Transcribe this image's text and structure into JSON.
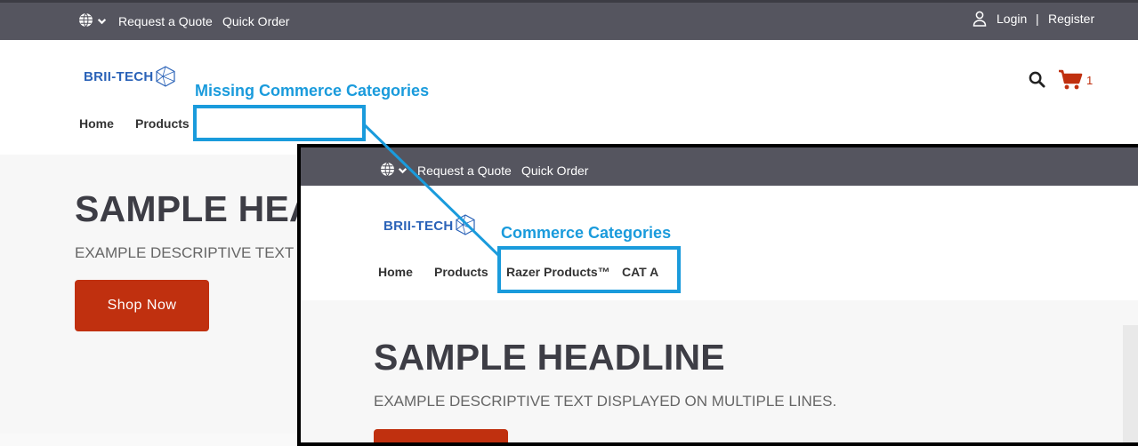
{
  "topbar": {
    "globe_icon": "globe-icon",
    "caret_icon": "chevron-down-icon",
    "request_quote": "Request a Quote",
    "quick_order": "Quick Order",
    "user_icon": "user-icon",
    "login": "Login",
    "separator": "|",
    "register": "Register"
  },
  "header": {
    "logo_text": "BRII-TECH",
    "search_icon": "search-icon",
    "cart_icon": "cart-icon",
    "cart_count": "1"
  },
  "nav": {
    "items": [
      "Home",
      "Products"
    ]
  },
  "hero": {
    "headline": "SAMPLE HEADLINE",
    "description": "EXAMPLE DESCRIPTIVE TEXT DISPLAYED ON MULTIPLE LINES.",
    "button": "Shop Now"
  },
  "annotations": {
    "missing_label": "Missing Commerce Categories",
    "present_label": "Commerce Categories"
  },
  "inset": {
    "request_quote": "Request a Quote",
    "quick_order": "Quick Order",
    "logo_text": "BRII-TECH",
    "nav_items": [
      "Home",
      "Products",
      "Razer Products™",
      "CAT A"
    ],
    "headline": "SAMPLE HEADLINE",
    "description": "EXAMPLE DESCRIPTIVE TEXT DISPLAYED ON MULTIPLE LINES."
  },
  "colors": {
    "topbar": "#55555f",
    "accent": "#c0300f",
    "callout": "#1a9bdc",
    "logo": "#2b63b8"
  }
}
